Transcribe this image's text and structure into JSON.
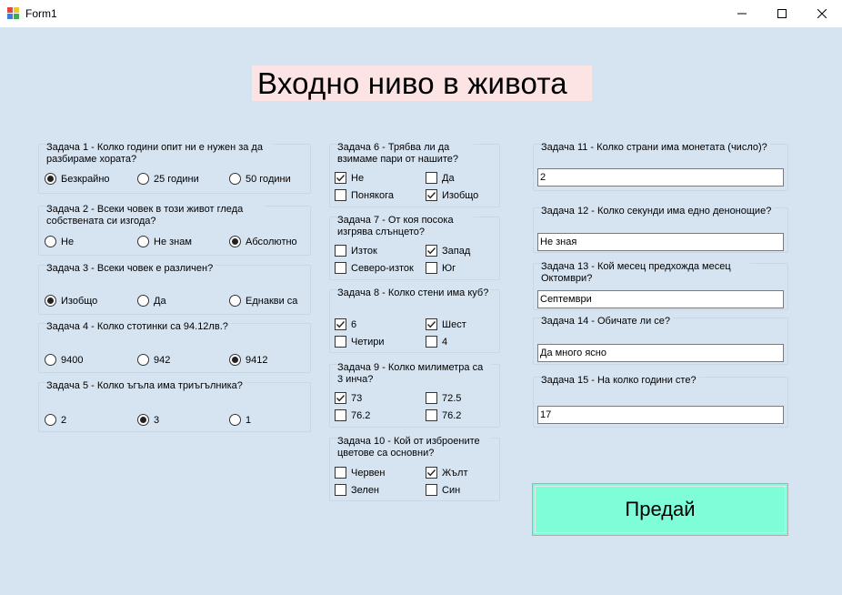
{
  "window": {
    "title": "Form1",
    "minimize_glyph": "—",
    "maximize_glyph": "☐",
    "close_glyph": "✕"
  },
  "heading": "Входно ниво в живота",
  "left_questions": [
    {
      "title": "Задача 1 - Колко години опит ни е нужен за да разбираме хората?",
      "options": [
        "Безкрайно",
        "25 години",
        "50 години"
      ],
      "selected": 0
    },
    {
      "title": "Задача 2 - Всеки човек в този живот гледа собствената си изгода?",
      "options": [
        "Не",
        "Не знам",
        "Абсолютно"
      ],
      "selected": 2
    },
    {
      "title": "Задача 3 - Всеки човек е различен?",
      "options": [
        "Изобщо",
        "Да",
        "Еднакви са"
      ],
      "selected": 0
    },
    {
      "title": "Задача 4 - Колко стотинки са 94.12лв.?",
      "options": [
        "9400",
        "942",
        "9412"
      ],
      "selected": 2
    },
    {
      "title": "Задача 5 - Колко ъгъла има триъгълника?",
      "options": [
        "2",
        "3",
        "1"
      ],
      "selected": 1
    }
  ],
  "middle_questions": [
    {
      "title": "Задача 6 - Трябва ли да взимаме пари от нашите?",
      "options": [
        {
          "label": "Не",
          "checked": true
        },
        {
          "label": "Да",
          "checked": false
        },
        {
          "label": "Понякога",
          "checked": false
        },
        {
          "label": "Изобщо",
          "checked": true
        }
      ]
    },
    {
      "title": "Задача 7 - От коя посока изгрява слънцето?",
      "options": [
        {
          "label": "Изток",
          "checked": false
        },
        {
          "label": "Запад",
          "checked": true
        },
        {
          "label": "Северо-изток",
          "checked": false
        },
        {
          "label": "Юг",
          "checked": false
        }
      ]
    },
    {
      "title": "Задача 8 - Колко стени има куб?",
      "options": [
        {
          "label": "6",
          "checked": true
        },
        {
          "label": "Шест",
          "checked": true
        },
        {
          "label": "Четири",
          "checked": false
        },
        {
          "label": "4",
          "checked": false
        }
      ]
    },
    {
      "title": "Задача 9 - Колко милиметра са 3 инча?",
      "options": [
        {
          "label": "73",
          "checked": true
        },
        {
          "label": "72.5",
          "checked": false
        },
        {
          "label": "76.2",
          "checked": false
        },
        {
          "label": "76.2",
          "checked": false
        }
      ]
    },
    {
      "title": "Задача 10 - Кой от изброените цветове са основни?",
      "options": [
        {
          "label": "Червен",
          "checked": false
        },
        {
          "label": "Жълт",
          "checked": true
        },
        {
          "label": "Зелен",
          "checked": false
        },
        {
          "label": "Син",
          "checked": false
        }
      ]
    }
  ],
  "right_questions": [
    {
      "title": "Задача 11 - Колко страни има монетата (число)?",
      "value": "2"
    },
    {
      "title": "Задача 12 - Колко секунди има едно денонощие?",
      "value": "Не зная"
    },
    {
      "title": "Задача 13 - Кой месец предхожда месец Октомври?",
      "value": "Септември"
    },
    {
      "title": "Задача 14 - Обичате ли се?",
      "value": "Да много ясно"
    },
    {
      "title": "Задача 15 - На колко години сте?",
      "value": "17"
    }
  ],
  "submit_label": "Предай",
  "colors": {
    "background": "#d6e4f2",
    "heading_bg": "#fde4e4",
    "submit_bg": "#7ffdd8"
  }
}
